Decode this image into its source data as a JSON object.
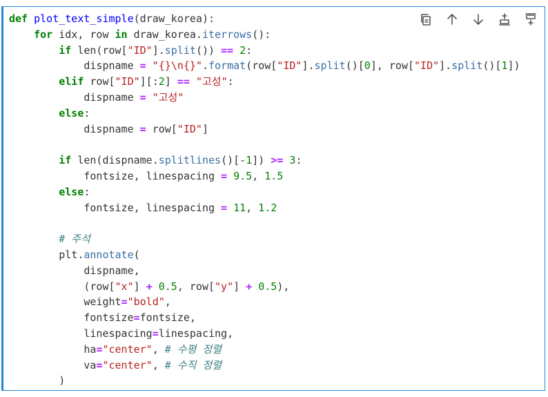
{
  "toolbar": {
    "buttons": [
      {
        "name": "copy-cell-icon",
        "icon": "copy"
      },
      {
        "name": "move-up-icon",
        "icon": "arrow-up"
      },
      {
        "name": "move-down-icon",
        "icon": "arrow-down"
      },
      {
        "name": "insert-above-icon",
        "icon": "insert-above"
      },
      {
        "name": "insert-below-icon",
        "icon": "insert-below"
      }
    ]
  },
  "code_lines": [
    [
      [
        "kw",
        "def"
      ],
      [
        "pl",
        " "
      ],
      [
        "fn",
        "plot_text_simple"
      ],
      [
        "pl",
        "(draw_korea):"
      ]
    ],
    [
      [
        "pl",
        "    "
      ],
      [
        "kw",
        "for"
      ],
      [
        "pl",
        " idx, row "
      ],
      [
        "kw",
        "in"
      ],
      [
        "pl",
        " draw_korea."
      ],
      [
        "attr",
        "iterrows"
      ],
      [
        "pl",
        "():"
      ]
    ],
    [
      [
        "pl",
        "        "
      ],
      [
        "kw",
        "if"
      ],
      [
        "pl",
        " len(row["
      ],
      [
        "str",
        "\"ID\""
      ],
      [
        "pl",
        "]."
      ],
      [
        "attr",
        "split"
      ],
      [
        "pl",
        "()) "
      ],
      [
        "op",
        "=="
      ],
      [
        "pl",
        " "
      ],
      [
        "num",
        "2"
      ],
      [
        "pl",
        ":"
      ]
    ],
    [
      [
        "pl",
        "            dispname "
      ],
      [
        "op",
        "="
      ],
      [
        "pl",
        " "
      ],
      [
        "str",
        "\"{}\\n{}\""
      ],
      [
        "pl",
        "."
      ],
      [
        "attr",
        "format"
      ],
      [
        "pl",
        "(row["
      ],
      [
        "str",
        "\"ID\""
      ],
      [
        "pl",
        "]."
      ],
      [
        "attr",
        "split"
      ],
      [
        "pl",
        "()["
      ],
      [
        "num",
        "0"
      ],
      [
        "pl",
        "], row["
      ],
      [
        "str",
        "\"ID\""
      ],
      [
        "pl",
        "]."
      ],
      [
        "attr",
        "split"
      ],
      [
        "pl",
        "()["
      ],
      [
        "num",
        "1"
      ],
      [
        "pl",
        "])"
      ]
    ],
    [
      [
        "pl",
        "        "
      ],
      [
        "kw",
        "elif"
      ],
      [
        "pl",
        " row["
      ],
      [
        "str",
        "\"ID\""
      ],
      [
        "pl",
        "][:"
      ],
      [
        "num",
        "2"
      ],
      [
        "pl",
        "] "
      ],
      [
        "op",
        "=="
      ],
      [
        "pl",
        " "
      ],
      [
        "str",
        "\"고성\""
      ],
      [
        "pl",
        ":"
      ]
    ],
    [
      [
        "pl",
        "            dispname "
      ],
      [
        "op",
        "="
      ],
      [
        "pl",
        " "
      ],
      [
        "str",
        "\"고성\""
      ]
    ],
    [
      [
        "pl",
        "        "
      ],
      [
        "kw",
        "else"
      ],
      [
        "pl",
        ":"
      ]
    ],
    [
      [
        "pl",
        "            dispname "
      ],
      [
        "op",
        "="
      ],
      [
        "pl",
        " row["
      ],
      [
        "str",
        "\"ID\""
      ],
      [
        "pl",
        "]"
      ]
    ],
    [
      [
        "pl",
        ""
      ]
    ],
    [
      [
        "pl",
        "        "
      ],
      [
        "kw",
        "if"
      ],
      [
        "pl",
        " len(dispname."
      ],
      [
        "attr",
        "splitlines"
      ],
      [
        "pl",
        "()[-"
      ],
      [
        "num",
        "1"
      ],
      [
        "pl",
        "]) "
      ],
      [
        "op",
        ">="
      ],
      [
        "pl",
        " "
      ],
      [
        "num",
        "3"
      ],
      [
        "pl",
        ":"
      ]
    ],
    [
      [
        "pl",
        "            fontsize, linespacing "
      ],
      [
        "op",
        "="
      ],
      [
        "pl",
        " "
      ],
      [
        "num",
        "9.5"
      ],
      [
        "pl",
        ", "
      ],
      [
        "num",
        "1.5"
      ]
    ],
    [
      [
        "pl",
        "        "
      ],
      [
        "kw",
        "else"
      ],
      [
        "pl",
        ":"
      ]
    ],
    [
      [
        "pl",
        "            fontsize, linespacing "
      ],
      [
        "op",
        "="
      ],
      [
        "pl",
        " "
      ],
      [
        "num",
        "11"
      ],
      [
        "pl",
        ", "
      ],
      [
        "num",
        "1.2"
      ]
    ],
    [
      [
        "pl",
        ""
      ]
    ],
    [
      [
        "pl",
        "        "
      ],
      [
        "cm",
        "# 주석"
      ]
    ],
    [
      [
        "pl",
        "        plt."
      ],
      [
        "attr",
        "annotate"
      ],
      [
        "pl",
        "("
      ]
    ],
    [
      [
        "pl",
        "            dispname,"
      ]
    ],
    [
      [
        "pl",
        "            (row["
      ],
      [
        "str",
        "\"x\""
      ],
      [
        "pl",
        "] "
      ],
      [
        "op",
        "+"
      ],
      [
        "pl",
        " "
      ],
      [
        "num",
        "0.5"
      ],
      [
        "pl",
        ", row["
      ],
      [
        "str",
        "\"y\""
      ],
      [
        "pl",
        "] "
      ],
      [
        "op",
        "+"
      ],
      [
        "pl",
        " "
      ],
      [
        "num",
        "0.5"
      ],
      [
        "pl",
        "),"
      ]
    ],
    [
      [
        "pl",
        "            weight"
      ],
      [
        "op",
        "="
      ],
      [
        "str",
        "\"bold\""
      ],
      [
        "pl",
        ","
      ]
    ],
    [
      [
        "pl",
        "            fontsize"
      ],
      [
        "op",
        "="
      ],
      [
        "pl",
        "fontsize,"
      ]
    ],
    [
      [
        "pl",
        "            linespacing"
      ],
      [
        "op",
        "="
      ],
      [
        "pl",
        "linespacing,"
      ]
    ],
    [
      [
        "pl",
        "            ha"
      ],
      [
        "op",
        "="
      ],
      [
        "str",
        "\"center\""
      ],
      [
        "pl",
        ", "
      ],
      [
        "cm",
        "# 수평 정렬"
      ]
    ],
    [
      [
        "pl",
        "            va"
      ],
      [
        "op",
        "="
      ],
      [
        "str",
        "\"center\""
      ],
      [
        "pl",
        ", "
      ],
      [
        "cm",
        "# 수직 정렬"
      ]
    ],
    [
      [
        "pl",
        "        )"
      ]
    ]
  ]
}
